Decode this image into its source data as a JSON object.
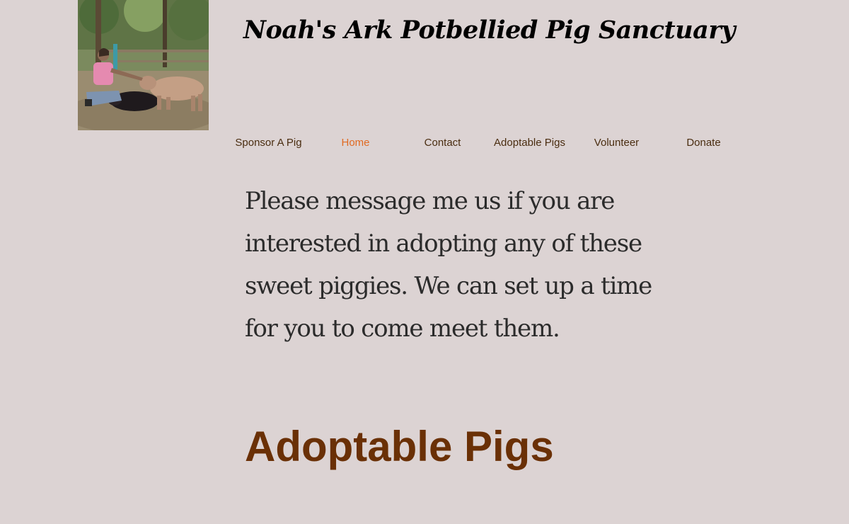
{
  "header": {
    "site_title": "Noah's Ark Potbellied Pig Sanctuary",
    "logo_image": "woman-petting-pigs-photo"
  },
  "nav": {
    "active": "Home",
    "items": [
      {
        "label": "Sponsor A Pig"
      },
      {
        "label": "Home"
      },
      {
        "label": "Contact"
      },
      {
        "label": "Adoptable Pigs"
      },
      {
        "label": "Volunteer"
      },
      {
        "label": "Donate"
      }
    ]
  },
  "main": {
    "intro_text": "Please message me us if you are interested in adopting any of these sweet piggies. We can set up a time for you to come meet them.",
    "section_heading": "Adoptable Pigs"
  },
  "colors": {
    "background": "#dcd3d3",
    "nav_text": "#4a2d10",
    "nav_active": "#e06a22",
    "heading": "#6a3006",
    "body_text": "#2b2b2b"
  }
}
